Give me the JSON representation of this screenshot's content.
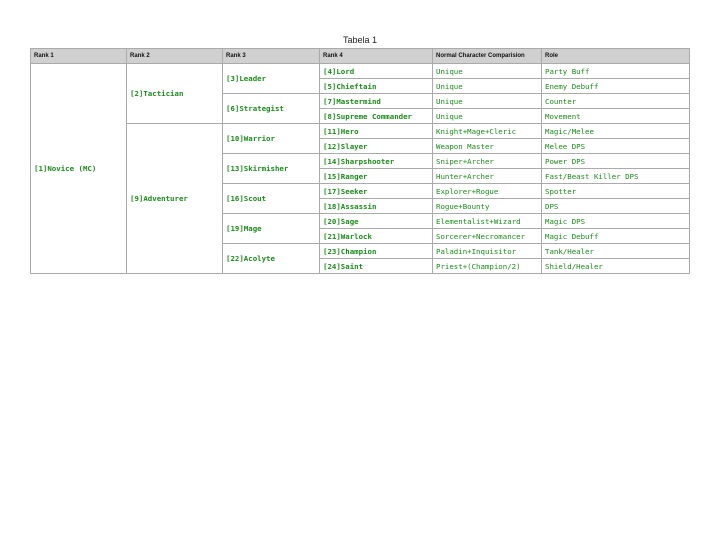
{
  "caption": "Tabela 1",
  "headers": [
    "Rank 1",
    "Rank 2",
    "Rank 3",
    "Rank 4",
    "Normal Character Comparision",
    "Role"
  ],
  "rank1": "[1]Novice (MC)",
  "rank2": [
    "[2]Tactician",
    "[9]Adventurer"
  ],
  "rank3": [
    "[3]Leader",
    "[6]Strategist",
    "[10]Warrior",
    "[13]Skirmisher",
    "[16]Scout",
    "[19]Mage",
    "[22]Acolyte"
  ],
  "rows": [
    {
      "rank4": "[4]Lord",
      "comparison": "Unique",
      "role": "Party Buff"
    },
    {
      "rank4": "[5]Chieftain",
      "comparison": "Unique",
      "role": "Enemy Debuff"
    },
    {
      "rank4": "[7]Mastermind",
      "comparison": "Unique",
      "role": "Counter"
    },
    {
      "rank4": "[8]Supreme Commander",
      "comparison": "Unique",
      "role": "Movement"
    },
    {
      "rank4": "[11]Hero",
      "comparison": "Knight+Mage+Cleric",
      "role": "Magic/Melee"
    },
    {
      "rank4": "[12]Slayer",
      "comparison": "Weapon Master",
      "role": "Melee DPS"
    },
    {
      "rank4": "[14]Sharpshooter",
      "comparison": "Sniper+Archer",
      "role": "Power DPS"
    },
    {
      "rank4": "[15]Ranger",
      "comparison": "Hunter+Archer",
      "role": "Fast/Beast Killer DPS"
    },
    {
      "rank4": "[17]Seeker",
      "comparison": "Explorer+Rogue",
      "role": "Spotter"
    },
    {
      "rank4": "[18]Assassin",
      "comparison": "Rogue+Bounty",
      "role": "DPS"
    },
    {
      "rank4": "[20]Sage",
      "comparison": "Elementalist+Wizard",
      "role": "Magic DPS"
    },
    {
      "rank4": "[21]Warlock",
      "comparison": "Sorcerer+Necromancer",
      "role": "Magic Debuff"
    },
    {
      "rank4": "[23]Champion",
      "comparison": "Paladin+Inquisitor",
      "role": "Tank/Healer"
    },
    {
      "rank4": "[24]Saint",
      "comparison": "Priest+(Champion/2)",
      "role": "Shield/Healer"
    }
  ]
}
